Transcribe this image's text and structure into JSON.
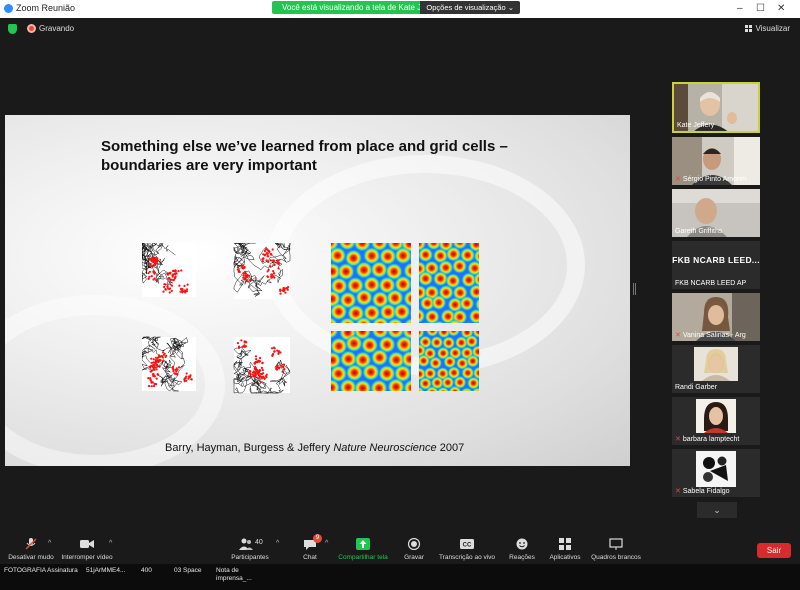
{
  "window": {
    "title": "Zoom Reunião",
    "share_banner": "Você está visualizando a tela de Kate Jeffery",
    "view_options": "Opções de visualização",
    "minimize": "–",
    "maximize": "☐",
    "close": "✕"
  },
  "topbar": {
    "recording_label": "Gravando",
    "view_label": "Visualizar"
  },
  "slide": {
    "title_line1": "Something else we’ve learned from place and grid cells –",
    "title_line2": "boundaries are very important",
    "citation_authors": "Barry, Hayman, Burgess & Jeffery ",
    "citation_journal": "Nature Neuroscience",
    "citation_year": " 2007"
  },
  "participants": [
    {
      "name": "Kate Jeffery",
      "muted": false,
      "active": true,
      "type": "video"
    },
    {
      "name": "Sérgio Pinto Amorim",
      "muted": true,
      "active": false,
      "type": "video"
    },
    {
      "name": "Gareth Griffiths",
      "muted": false,
      "active": false,
      "type": "video"
    },
    {
      "name": "FKB NCARB LEED AP",
      "display_text": "FKB NCARB LEED...",
      "muted": false,
      "active": false,
      "type": "text"
    },
    {
      "name": "Vanina Salinas - Arg",
      "muted": true,
      "active": false,
      "type": "video"
    },
    {
      "name": "Randi Garber",
      "muted": false,
      "active": false,
      "type": "photo"
    },
    {
      "name": "barbara lamptecht",
      "muted": true,
      "active": false,
      "type": "photo"
    },
    {
      "name": "Sabela Fidalgo",
      "muted": true,
      "active": false,
      "type": "photo"
    }
  ],
  "toolbar": {
    "mute": "Desativar mudo",
    "stop_video": "Interromper vídeo",
    "participants": "Participantes",
    "participants_count": "40",
    "chat": "Chat",
    "chat_badge": "9",
    "share": "Compartilhar tela",
    "record": "Gravar",
    "transcript": "Transcrição ao vivo",
    "reactions": "Reações",
    "apps": "Aplicativos",
    "whiteboards": "Quadros brancos",
    "leave": "Sair"
  },
  "taskbar": [
    {
      "label": "FOTOGRAFIA"
    },
    {
      "label": "Assinatura"
    },
    {
      "label": "51jArMME4..."
    },
    {
      "label": "400"
    },
    {
      "label": "03 Space"
    },
    {
      "label": "Nota de imprensa_..."
    }
  ],
  "colors": {
    "share_green": "#23c552",
    "leave_red": "#d92b2b",
    "active_speaker": "#c9d23a",
    "app_bg": "#1a1a1a"
  }
}
